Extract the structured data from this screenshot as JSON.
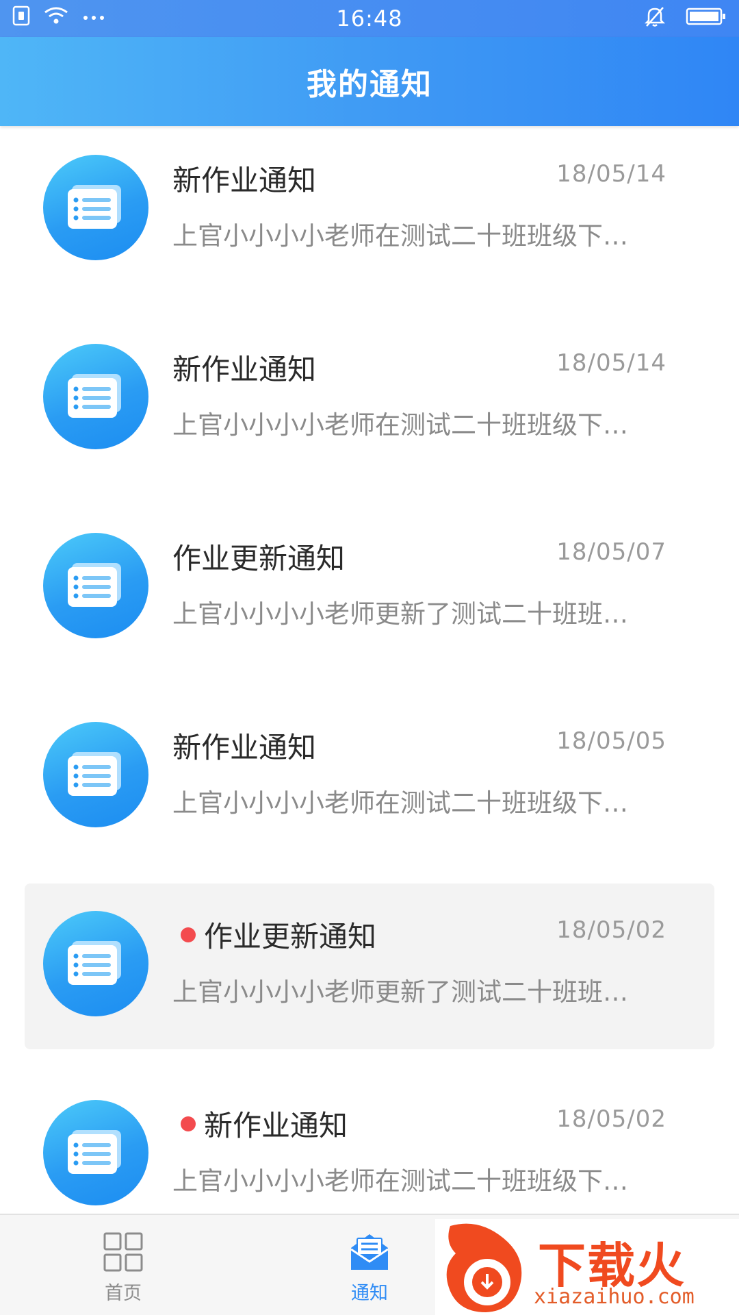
{
  "status_bar": {
    "time": "16:48"
  },
  "header": {
    "title": "我的通知"
  },
  "notifications": [
    {
      "title": "新作业通知",
      "date": "18/05/14",
      "summary": "上官小小小小老师在测试二十班班级下…",
      "unread": false,
      "active": false
    },
    {
      "title": "新作业通知",
      "date": "18/05/14",
      "summary": "上官小小小小老师在测试二十班班级下…",
      "unread": false,
      "active": false
    },
    {
      "title": "作业更新通知",
      "date": "18/05/07",
      "summary": "上官小小小小老师更新了测试二十班班…",
      "unread": false,
      "active": false
    },
    {
      "title": "新作业通知",
      "date": "18/05/05",
      "summary": "上官小小小小老师在测试二十班班级下…",
      "unread": false,
      "active": false
    },
    {
      "title": "作业更新通知",
      "date": "18/05/02",
      "summary": "上官小小小小老师更新了测试二十班班…",
      "unread": true,
      "active": true
    },
    {
      "title": "新作业通知",
      "date": "18/05/02",
      "summary": "上官小小小小老师在测试二十班班级下…",
      "unread": true,
      "active": false
    }
  ],
  "tabbar": {
    "home_label": "首页",
    "notice_label": "通知"
  },
  "watermark": {
    "text": "下载火",
    "url": "xiazaihuo.com"
  },
  "colors": {
    "header_gradient_start": "#4fb6f7",
    "header_gradient_end": "#2f86f5",
    "unread_dot": "#f34b4e",
    "tab_active": "#2f8cf5",
    "tab_inactive": "#8c8c8c"
  },
  "icons": {
    "avatar": "notice-list-icon",
    "home_tab": "grid-icon",
    "notice_tab": "envelope-icon"
  }
}
